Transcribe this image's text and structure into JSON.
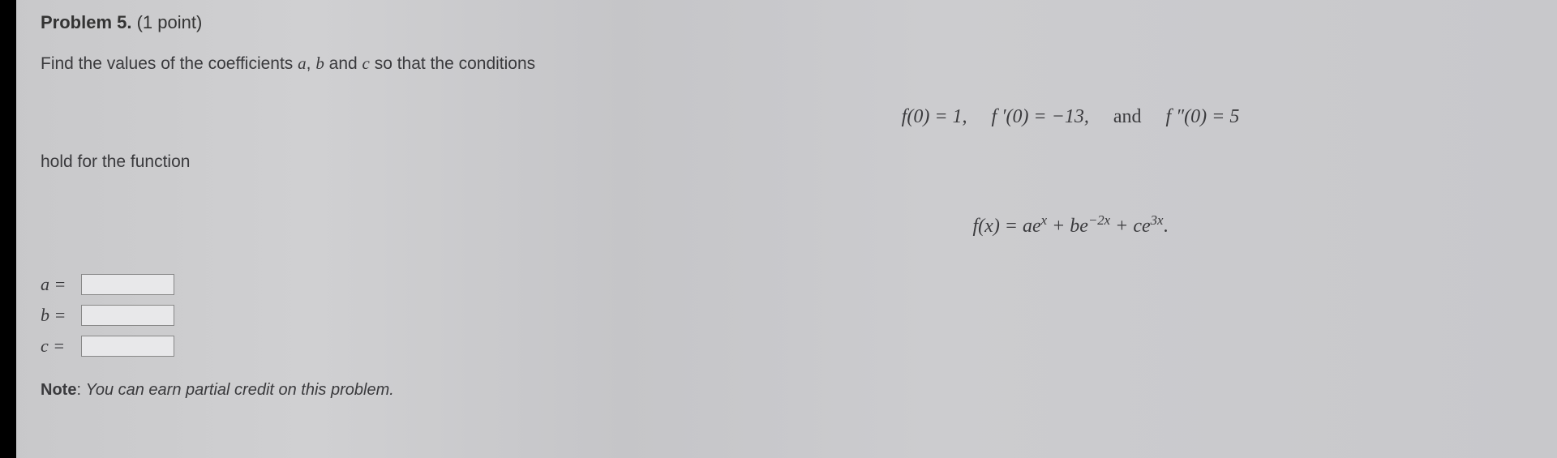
{
  "problem": {
    "title_bold": "Problem 5.",
    "title_points": "(1 point)",
    "intro": "Find the values of the coefficients ",
    "intro_vars": {
      "a": "a",
      "b": "b",
      "c": "c"
    },
    "intro_mid1": ", ",
    "intro_mid2": " and ",
    "intro_end": " so that the conditions",
    "conditions": {
      "f0_lhs": "f(0) = 1,",
      "fp0_lhs": "f ′(0) = −13,",
      "and_text": "and",
      "fpp0_lhs": "f ″(0) = 5"
    },
    "hold_text": "hold for the function",
    "function_def": {
      "lhs": "f(x) = ae",
      "exp1": "x",
      "plus1": " + be",
      "exp2": "−2x",
      "plus2": " + ce",
      "exp3": "3x",
      "end": "."
    }
  },
  "answers": {
    "a_label": "a =",
    "a_value": "",
    "b_label": "b =",
    "b_value": "",
    "c_label": "c =",
    "c_value": ""
  },
  "note": {
    "label": "Note",
    "colon": ": ",
    "text": "You can earn partial credit on this problem."
  }
}
